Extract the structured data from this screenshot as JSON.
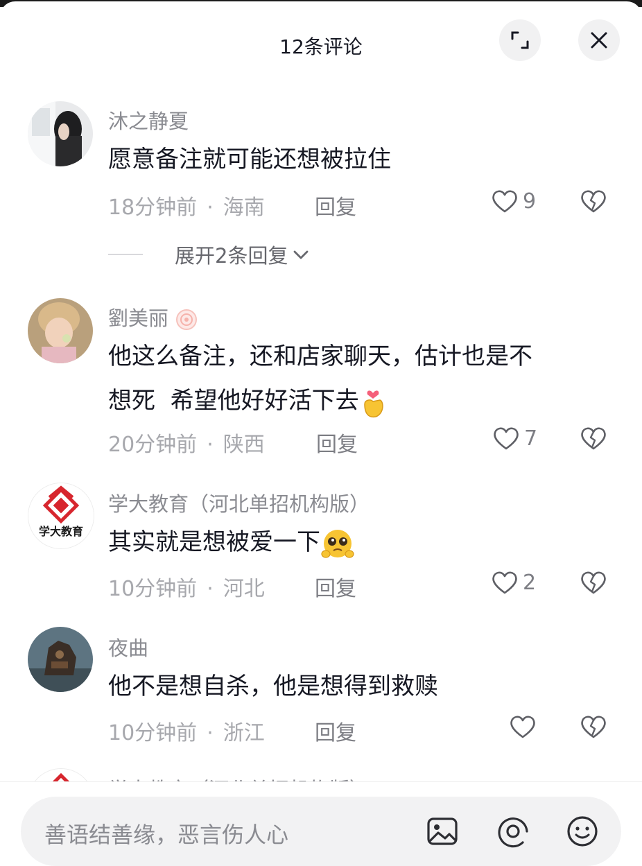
{
  "header": {
    "title": "12条评论"
  },
  "comments": [
    {
      "name": "沐之静夏",
      "text": "愿意备注就可能还想被拉住",
      "time": "18分钟前",
      "location": "海南",
      "reply_label": "回复",
      "likes": "9",
      "expand_label": "展开2条回复"
    },
    {
      "name": "劉美丽",
      "text_line1": "他这么备注，还和店家聊天，估计也是不",
      "text_line2": "想死  希望他好好活下去",
      "time": "20分钟前",
      "location": "陕西",
      "reply_label": "回复",
      "likes": "7"
    },
    {
      "name": "学大教育（河北单招机构版）",
      "text": "其实就是想被爱一下",
      "time": "10分钟前",
      "location": "河北",
      "reply_label": "回复",
      "likes": "2",
      "avatar_text": "学大教育"
    },
    {
      "name": "夜曲",
      "text": "他不是想自杀，他是想得到救赎",
      "time": "10分钟前",
      "location": "浙江",
      "reply_label": "回复",
      "likes": ""
    },
    {
      "name": "学大教育（河北单招机构版）"
    }
  ],
  "input": {
    "placeholder": "善语结善缘，恶言伤人心"
  },
  "colors": {
    "brand_red": "#d7262e",
    "heart_pink": "#f5607a",
    "emoji_yellow": "#f7c433"
  },
  "icons": [
    "expand-icon",
    "close-icon",
    "heart-icon",
    "broken-heart-icon",
    "image-icon",
    "at-icon",
    "emoji-icon"
  ]
}
